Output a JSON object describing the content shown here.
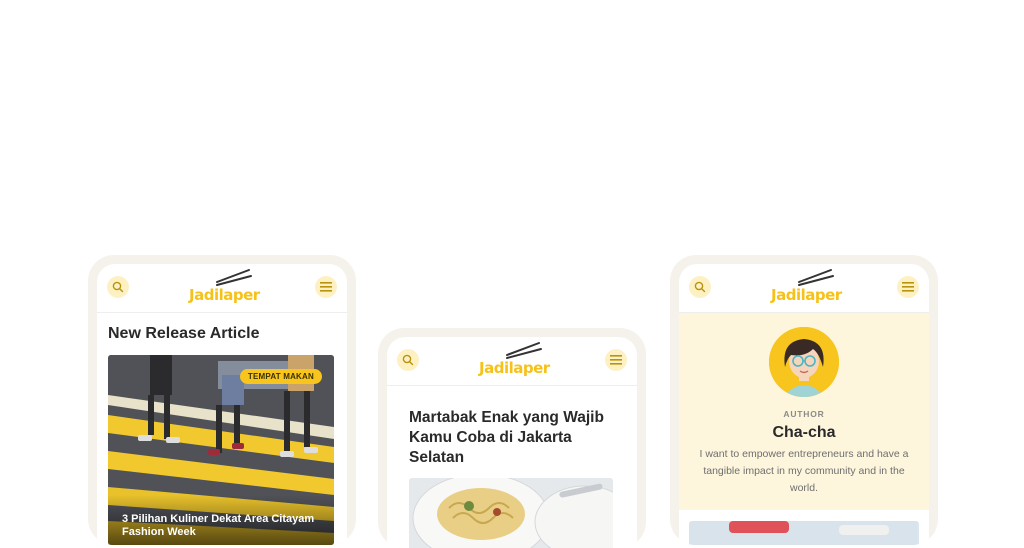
{
  "brand": {
    "logo_text": "Jadilaper",
    "accent": "#f7c51e"
  },
  "icons": {
    "search": "search-icon",
    "menu": "menu-icon"
  },
  "phone1": {
    "section_title": "New Release Article",
    "card": {
      "badge": "TEMPAT MAKAN",
      "title": "3 Pilihan Kuliner Dekat Area Citayam Fashion Week"
    }
  },
  "phone2": {
    "article_title": "Martabak Enak yang Wajib Kamu Coba di Jakarta Selatan"
  },
  "phone3": {
    "author_role": "AUTHOR",
    "author_name": "Cha-cha",
    "author_bio": "I want to empower entrepreneurs and have a tangible impact in my community and in the world."
  }
}
